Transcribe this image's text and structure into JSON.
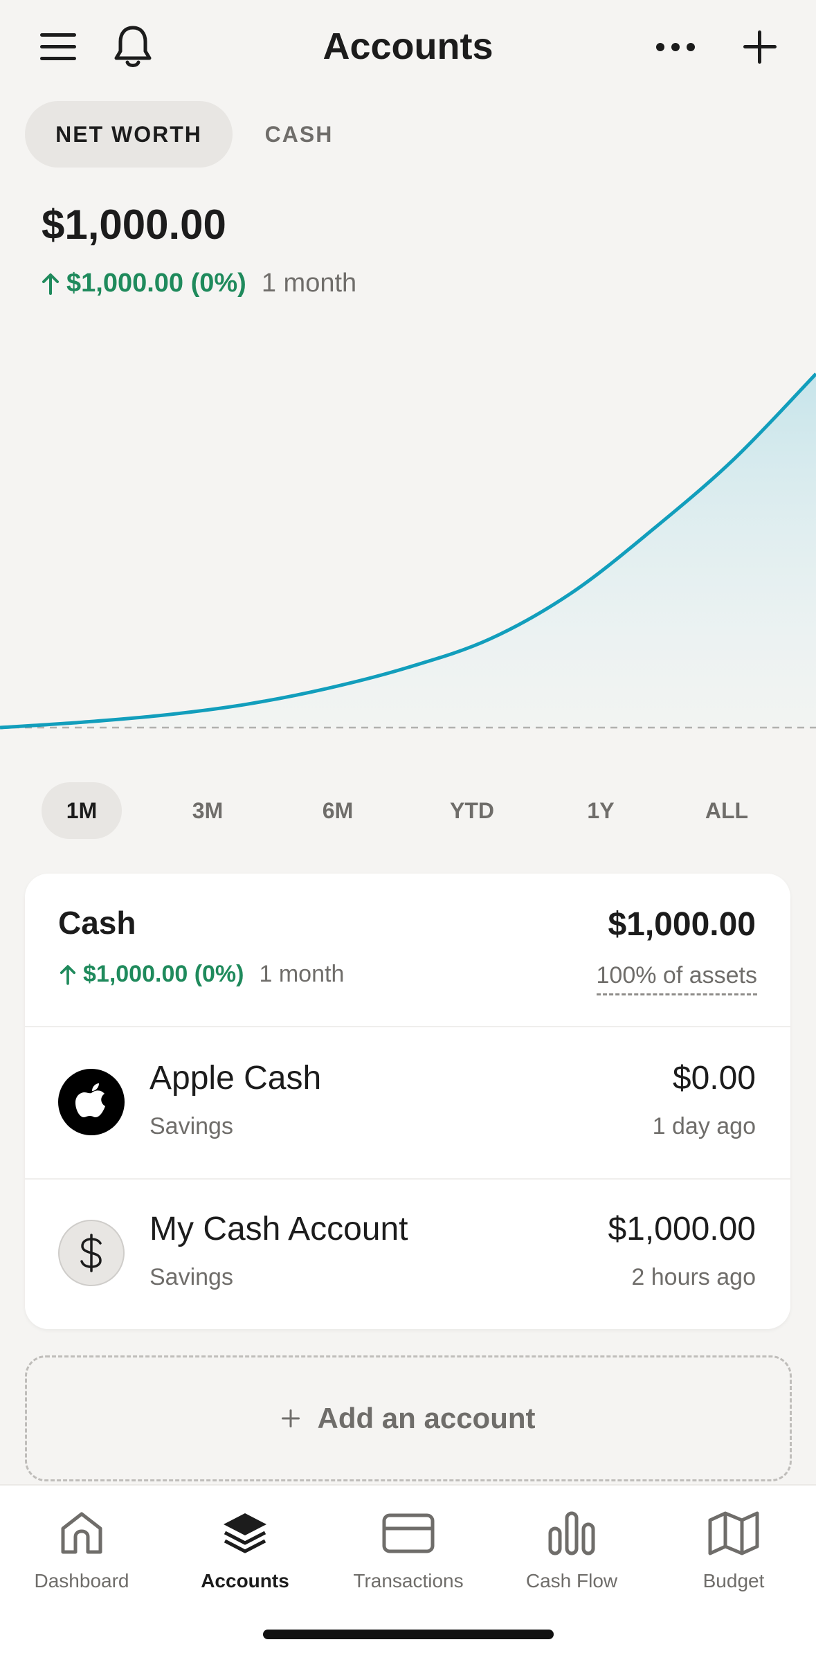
{
  "header": {
    "title": "Accounts",
    "icons": [
      "menu-icon",
      "bell-icon",
      "more-icon",
      "plus-icon"
    ]
  },
  "toggle": {
    "net_worth": "NET WORTH",
    "cash": "CASH",
    "selected": "NET WORTH"
  },
  "summary": {
    "amount": "$1,000.00",
    "change": "$1,000.00 (0%)",
    "period": "1 month",
    "trend": "up"
  },
  "chart_data": {
    "type": "area",
    "x": [
      0,
      0.1,
      0.2,
      0.3,
      0.4,
      0.5,
      0.6,
      0.7,
      0.8,
      0.9,
      1.0
    ],
    "values": [
      0,
      15,
      35,
      65,
      110,
      170,
      250,
      380,
      560,
      760,
      1000
    ],
    "ylim": [
      0,
      1000
    ],
    "baseline_dashed": true,
    "color": "#129ebc",
    "fill": "#cfe8ec"
  },
  "ranges": [
    "1M",
    "3M",
    "6M",
    "YTD",
    "1Y",
    "ALL"
  ],
  "selected_range": "1M",
  "cash_group": {
    "title": "Cash",
    "total": "$1,000.00",
    "change": "$1,000.00 (0%)",
    "period": "1 month",
    "assets_pct": "100% of assets"
  },
  "accounts": [
    {
      "name": "Apple Cash",
      "type": "Savings",
      "balance": "$0.00",
      "updated": "1 day ago",
      "icon": "apple-icon"
    },
    {
      "name": "My Cash Account",
      "type": "Savings",
      "balance": "$1,000.00",
      "updated": "2 hours ago",
      "icon": "dollar-icon"
    }
  ],
  "add_account": "Add an account",
  "nav": [
    {
      "label": "Dashboard",
      "icon": "home-icon"
    },
    {
      "label": "Accounts",
      "icon": "layers-icon",
      "active": true
    },
    {
      "label": "Transactions",
      "icon": "card-icon"
    },
    {
      "label": "Cash Flow",
      "icon": "bar-chart-icon"
    },
    {
      "label": "Budget",
      "icon": "map-icon"
    }
  ],
  "colors": {
    "green": "#1f8a5c",
    "accent": "#129ebc",
    "background": "#f5f4f2"
  }
}
